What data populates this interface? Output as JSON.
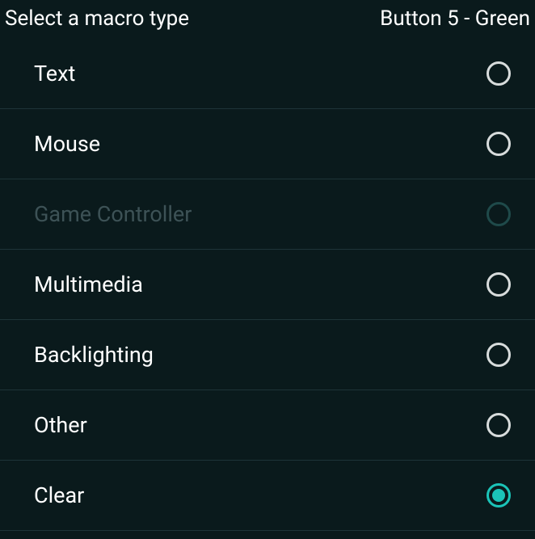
{
  "header": {
    "title": "Select a macro type",
    "context": "Button 5 - Green"
  },
  "items": [
    {
      "label": "Text",
      "state": "default"
    },
    {
      "label": "Mouse",
      "state": "default"
    },
    {
      "label": "Game Controller",
      "state": "disabled"
    },
    {
      "label": "Multimedia",
      "state": "default"
    },
    {
      "label": "Backlighting",
      "state": "default"
    },
    {
      "label": "Other",
      "state": "default"
    },
    {
      "label": "Clear",
      "state": "selected"
    }
  ]
}
